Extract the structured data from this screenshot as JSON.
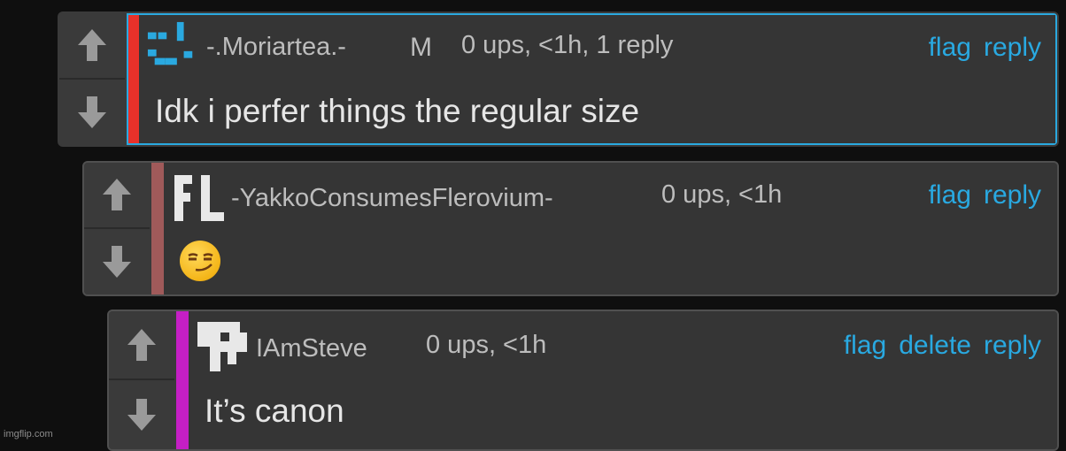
{
  "comments": [
    {
      "username": "-.Moriartea.-",
      "badge": "M",
      "meta": "0 ups, <1h, 1 reply",
      "text": "Idk i perfer things the regular size",
      "actions": [
        "flag",
        "reply"
      ],
      "stripe_color": "#e8312a"
    },
    {
      "username": "-YakkoConsumesFlerovium-",
      "avatar_text": "FL",
      "meta": "0 ups, <1h",
      "text": "😏",
      "actions": [
        "flag",
        "reply"
      ],
      "stripe_color": "#a05a5a"
    },
    {
      "username": "IAmSteve",
      "meta": "0 ups, <1h",
      "text": "It’s canon",
      "actions": [
        "flag",
        "delete",
        "reply"
      ],
      "stripe_color": "#c51fc5"
    }
  ],
  "colors": {
    "accent": "#29a9e1",
    "background": "#0f0f0f"
  },
  "watermark": "imgflip.com"
}
